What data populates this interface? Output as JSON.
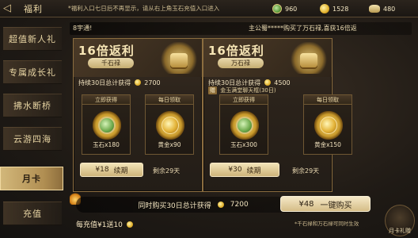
{
  "topbar": {
    "back_icon": "back-arrow-icon",
    "title": "福利",
    "notice": "*福利入口七日后不再显示，请从右上角玉石充值入口进入",
    "currencies": [
      {
        "icon": "jade-icon",
        "value": "960"
      },
      {
        "icon": "gold-coin-icon",
        "value": "1528"
      },
      {
        "icon": "silver-ingot-icon",
        "value": "480"
      }
    ]
  },
  "nav": {
    "items": [
      {
        "label": "超值新人礼",
        "active": false
      },
      {
        "label": "专属成长礼",
        "active": false
      },
      {
        "label": "拂水断桥",
        "active": false
      },
      {
        "label": "云游四海",
        "active": false
      },
      {
        "label": "月卡",
        "active": true
      },
      {
        "label": "充值",
        "active": false
      }
    ]
  },
  "ticker": {
    "left": "8宇通!",
    "right": "主公蜀*****购买了万石禄,喜获16倍返"
  },
  "cards": [
    {
      "return_text": "16倍返利",
      "plate": "千石禄",
      "sum_text_prefix": "持续30日总计获得",
      "sum_value": "2700",
      "bonus": "",
      "instant_label": "立即获得",
      "daily_label": "每日领取",
      "instant_item": "玉石x180",
      "daily_item": "黄金x90",
      "price": "¥18",
      "price_action": "续期",
      "remaining": "剩余29天"
    },
    {
      "return_text": "16倍返利",
      "plate": "万石禄",
      "sum_text_prefix": "持续30日总计获得",
      "sum_value": "4500",
      "bonus_tag": "赠",
      "bonus": "金玉满堂聊天框(30日)",
      "instant_label": "立即获得",
      "daily_label": "每日领取",
      "instant_item": "玉石x300",
      "daily_item": "黄金x150",
      "price": "¥30",
      "price_action": "续期",
      "remaining": "剩余29天"
    }
  ],
  "bottom": {
    "combo_text": "同时购买30日总计获得",
    "combo_value": "7200",
    "bundle_price": "¥48",
    "bundle_action": "一键购买",
    "note": "*千石禄和万石禄可同时生效",
    "recharge_text": "每充值¥1送10",
    "corner_label": "月卡礼赠"
  },
  "colors": {
    "accent_gold": "#d2b77a",
    "panel_border": "#8b6d3f",
    "text_light": "#f1e2bf"
  }
}
